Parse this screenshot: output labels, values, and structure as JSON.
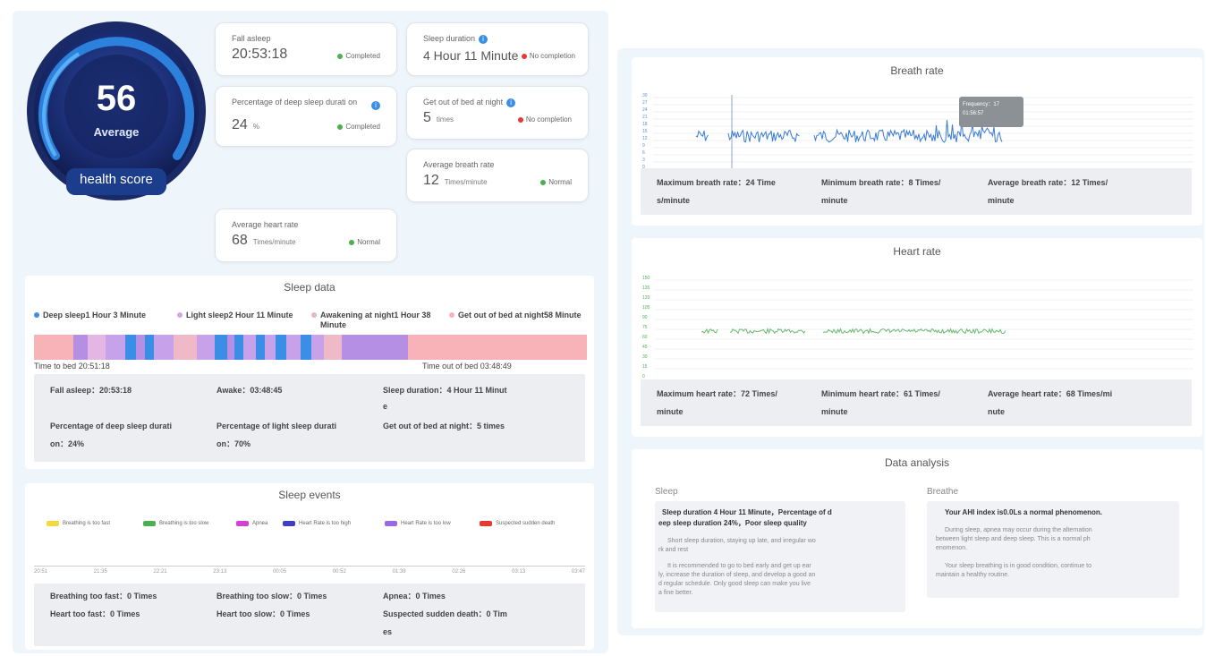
{
  "score": {
    "value": "56",
    "grade": "Average",
    "label": "health score"
  },
  "metrics": {
    "fall_asleep": {
      "label": "Fall asleep",
      "value": "20:53:18",
      "status": "Completed",
      "status_color": "#4caf50"
    },
    "sleep_duration": {
      "label": "Sleep duration",
      "value": "4 Hour 11 Minute",
      "status": "No completion",
      "status_color": "#e53935"
    },
    "deep_sleep_pct": {
      "label": "Percentage of deep sleep durati on",
      "value": "24",
      "unit": "%",
      "status": "Completed",
      "status_color": "#4caf50"
    },
    "get_out_bed": {
      "label": "Get out of bed at night",
      "value": "5",
      "unit": "times",
      "status": "No completion",
      "status_color": "#e53935"
    },
    "avg_breath": {
      "label": "Average breath rate",
      "value": "12",
      "unit": "Times/minute",
      "status": "Normal",
      "status_color": "#4caf50"
    },
    "avg_heart": {
      "label": "Average heart rate",
      "value": "68",
      "unit": "Times/minute",
      "status": "Normal",
      "status_color": "#4caf50"
    }
  },
  "sleep_data": {
    "title": "Sleep data",
    "legend": [
      {
        "text": "Deep sleep1 Hour 3 Minute",
        "color": "#3a8ee6"
      },
      {
        "text": "Light sleep2 Hour 11 Minute",
        "color": "#c9a7e8"
      },
      {
        "text": "Awakening at night1 Hour 38 Minute",
        "color": "#e8b4c8"
      },
      {
        "text": "Get out of bed at night58 Minute",
        "color": "#f4b6b6"
      }
    ],
    "time_to_bed": "Time to bed 20:51:18",
    "time_out_bed": "Time out of bed 03:48:49",
    "details": {
      "fall_asleep": "Fall asleep：20:53:18",
      "awake": "Awake：03:48:45",
      "duration_1": "Sleep duration：4 Hour 11 Minut",
      "duration_2": "e",
      "deep_pct_1": "Percentage of deep sleep durati",
      "deep_pct_2": "on：24%",
      "light_pct_1": "Percentage of light sleep durati",
      "light_pct_2": "on：70%",
      "out_bed": "Get out of bed at night：5 times"
    }
  },
  "sleep_events": {
    "title": "Sleep events",
    "legend": [
      {
        "text": "Breathing is too fast",
        "color": "#f5d742"
      },
      {
        "text": "Breathing is too slow",
        "color": "#4caf50"
      },
      {
        "text": "Apnea",
        "color": "#d63fd6"
      },
      {
        "text": "Heart Rate is too high",
        "color": "#3f3fbf"
      },
      {
        "text": "Heart Rate is too low",
        "color": "#9a6ae0"
      },
      {
        "text": "Suspected sudden death",
        "color": "#e53935"
      }
    ],
    "ticks": [
      "20:51",
      "21:35",
      "22:21",
      "23:13",
      "00:05",
      "00:52",
      "01:39",
      "02:26",
      "03:13",
      "03:47"
    ],
    "details": {
      "fast": "Breathing too fast：0 Times",
      "slow": "Breathing too slow：0 Times",
      "apnea": "Apnea：0 Times",
      "heart_fast": "Heart too fast：0 Times",
      "heart_slow": "Heart too slow：0 Times",
      "sudden_1": "Suspected sudden death：0 Tim",
      "sudden_2": "es"
    }
  },
  "breath_rate": {
    "title": "Breath rate",
    "tooltip_1": "Frequency：17",
    "tooltip_2": "01:56:57",
    "yticks": [
      "30",
      "27",
      "24",
      "21",
      "18",
      "15",
      "12",
      "9",
      "6",
      "3",
      "0"
    ],
    "max_1": "Maximum breath rate：24 Time",
    "max_2": "s/minute",
    "min_1": "Minimum breath rate：8 Times/",
    "min_2": "minute",
    "avg_1": "Average breath rate：12 Times/",
    "avg_2": "minute"
  },
  "heart_rate": {
    "title": "Heart rate",
    "yticks": [
      "150",
      "135",
      "120",
      "105",
      "90",
      "75",
      "60",
      "45",
      "30",
      "15",
      "0"
    ],
    "max_1": "Maximum heart rate：72 Times/",
    "max_2": "minute",
    "min_1": "Minimum heart rate：61 Times/",
    "min_2": "minute",
    "avg_1": "Average heart rate：68 Times/mi",
    "avg_2": "nute"
  },
  "analysis": {
    "title": "Data analysis",
    "sleep": {
      "heading": "Sleep",
      "bold_1": "Sleep duration 4 Hour 11 Minute，Percentage of d",
      "bold_2": "eep sleep duration 24%，Poor sleep quality",
      "p1_1": "Short sleep duration, staying up late, and irregular wo",
      "p1_2": "rk and rest",
      "p2_1": "It is recommended to go to bed early and get up ear",
      "p2_2": "ly, increase the duration of sleep, and develop a good an",
      "p2_3": "d regular schedule. Only good sleep can make you live",
      "p2_4": "a fine better."
    },
    "breathe": {
      "heading": "Breathe",
      "bold_1": "Your AHI index is0.0Ls a normal phenomenon.",
      "p1_1": "During sleep, apnea may occur during the alternation",
      "p1_2": "between light sleep and deep sleep. This is a normal ph",
      "p1_3": "enomenon.",
      "p2_1": "Your sleep breathing is in good condition, continue to",
      "p2_2": "maintain a healthy routine."
    }
  }
}
